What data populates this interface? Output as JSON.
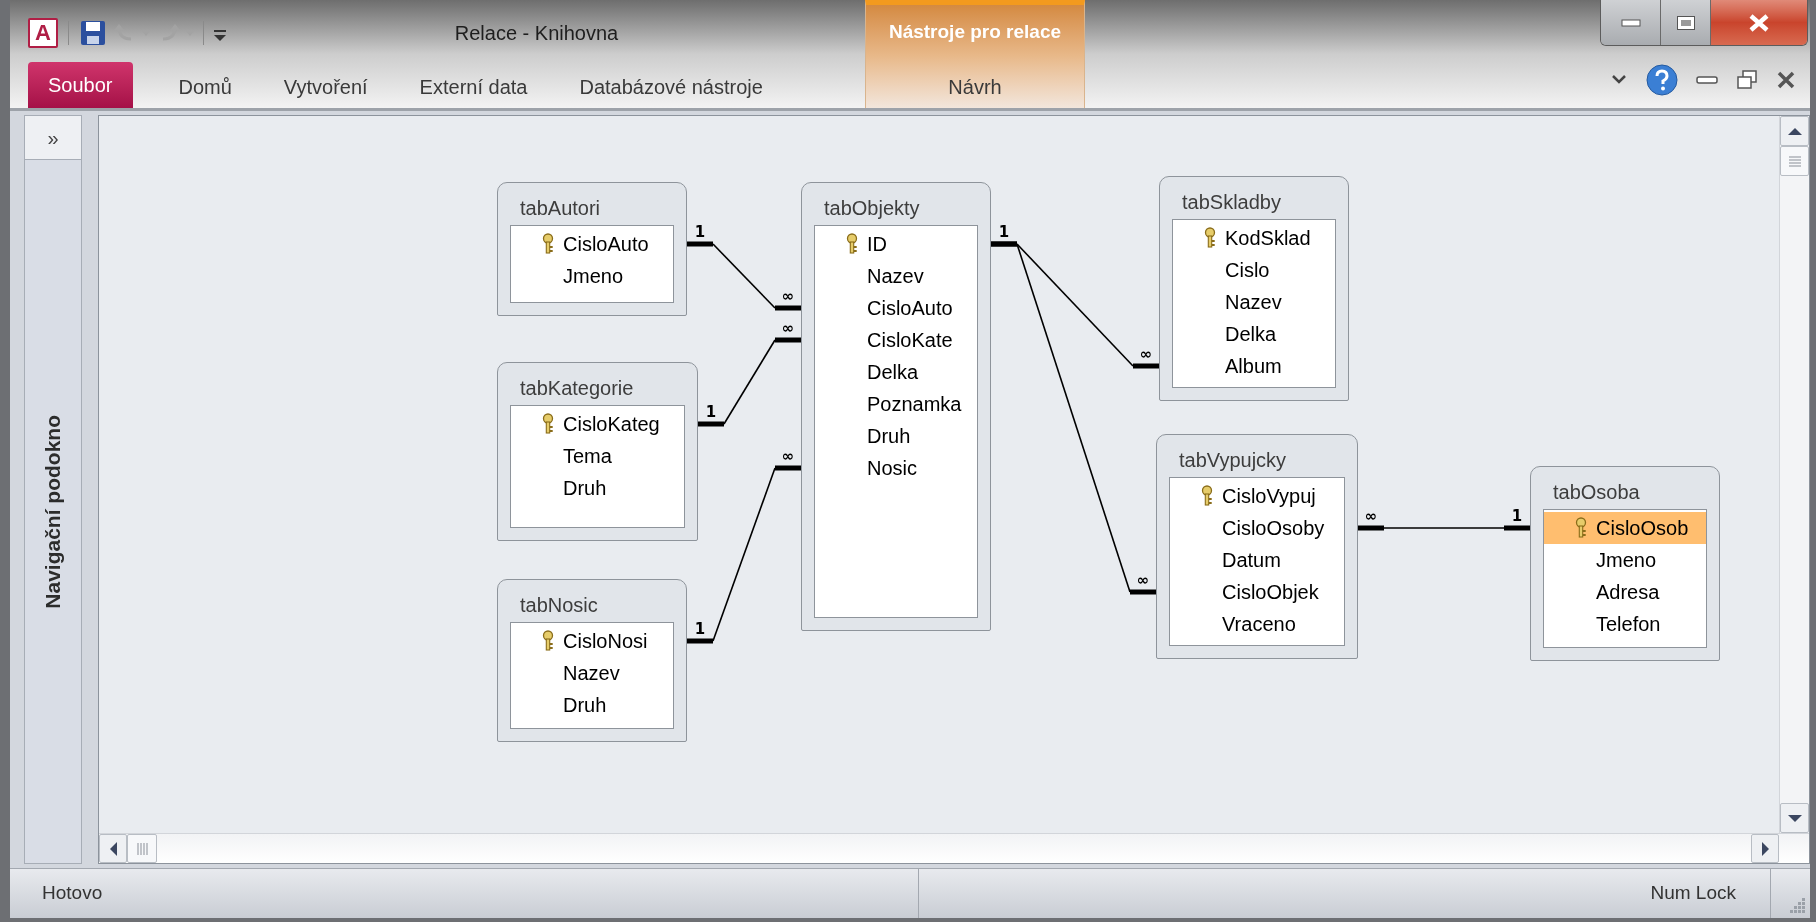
{
  "window": {
    "app_icon": "A",
    "title": "Relace - Knihovna"
  },
  "quick_access": [
    {
      "kind": "save",
      "disabled": false
    },
    {
      "kind": "undo",
      "disabled": true
    },
    {
      "kind": "redo",
      "disabled": true
    },
    {
      "kind": "customize"
    }
  ],
  "contextual_group": {
    "label": "Nástroje pro relace"
  },
  "tabs": [
    {
      "label": "Soubor",
      "kind": "file",
      "selected": false
    },
    {
      "label": "Domů",
      "kind": "tab",
      "selected": false
    },
    {
      "label": "Vytvoření",
      "kind": "tab",
      "selected": false
    },
    {
      "label": "Externí data",
      "kind": "tab",
      "selected": false
    },
    {
      "label": "Databázové nástroje",
      "kind": "tab",
      "selected": false
    },
    {
      "label": "Návrh",
      "kind": "contextual",
      "selected": false
    }
  ],
  "nav_pane": {
    "expand_glyph": "»",
    "label": "Navigační podokno"
  },
  "tables": [
    {
      "title": "tabAutori",
      "fields": [
        {
          "name": "CisloAuto",
          "key": true,
          "selected": false
        },
        {
          "name": "Jmeno",
          "key": false,
          "selected": false
        }
      ]
    },
    {
      "title": "tabObjekty",
      "fields": [
        {
          "name": "ID",
          "key": true,
          "selected": false
        },
        {
          "name": "Nazev",
          "key": false,
          "selected": false
        },
        {
          "name": "CisloAuto",
          "key": false,
          "selected": false
        },
        {
          "name": "CisloKate",
          "key": false,
          "selected": false
        },
        {
          "name": "Delka",
          "key": false,
          "selected": false
        },
        {
          "name": "Poznamka",
          "key": false,
          "selected": false
        },
        {
          "name": "Druh",
          "key": false,
          "selected": false
        },
        {
          "name": "Nosic",
          "key": false,
          "selected": false
        }
      ]
    },
    {
      "title": "tabKategorie",
      "fields": [
        {
          "name": "CisloKateg",
          "key": true,
          "selected": false
        },
        {
          "name": "Tema",
          "key": false,
          "selected": false
        },
        {
          "name": "Druh",
          "key": false,
          "selected": false
        }
      ]
    },
    {
      "title": "tabNosic",
      "fields": [
        {
          "name": "CisloNosi",
          "key": true,
          "selected": false
        },
        {
          "name": "Nazev",
          "key": false,
          "selected": false
        },
        {
          "name": "Druh",
          "key": false,
          "selected": false
        }
      ]
    },
    {
      "title": "tabSkladby",
      "fields": [
        {
          "name": "KodSklad",
          "key": true,
          "selected": false
        },
        {
          "name": "Cislo",
          "key": false,
          "selected": false
        },
        {
          "name": "Nazev",
          "key": false,
          "selected": false
        },
        {
          "name": "Delka",
          "key": false,
          "selected": false
        },
        {
          "name": "Album",
          "key": false,
          "selected": false
        }
      ]
    },
    {
      "title": "tabVypujcky",
      "fields": [
        {
          "name": "CisloVypuj",
          "key": true,
          "selected": false
        },
        {
          "name": "CisloOsoby",
          "key": false,
          "selected": false
        },
        {
          "name": "Datum",
          "key": false,
          "selected": false
        },
        {
          "name": "CisloObjek",
          "key": false,
          "selected": false
        },
        {
          "name": "Vraceno",
          "key": false,
          "selected": false
        }
      ]
    },
    {
      "title": "tabOsoba",
      "fields": [
        {
          "name": "CisloOsob",
          "key": true,
          "selected": true
        },
        {
          "name": "Jmeno",
          "key": false,
          "selected": false
        },
        {
          "name": "Adresa",
          "key": false,
          "selected": false
        },
        {
          "name": "Telefon",
          "key": false,
          "selected": false
        }
      ]
    }
  ],
  "relationships": [
    {
      "from_label": "1",
      "to_label": "∞"
    },
    {
      "from_label": "1",
      "to_label": "∞"
    },
    {
      "from_label": "1",
      "to_label": "∞"
    },
    {
      "from_label": "1",
      "to_label": "∞"
    },
    {
      "to_label": "∞"
    },
    {
      "from_label": "∞",
      "to_label": "1"
    }
  ],
  "status_bar": {
    "left": "Hotovo",
    "right": "Num Lock"
  }
}
